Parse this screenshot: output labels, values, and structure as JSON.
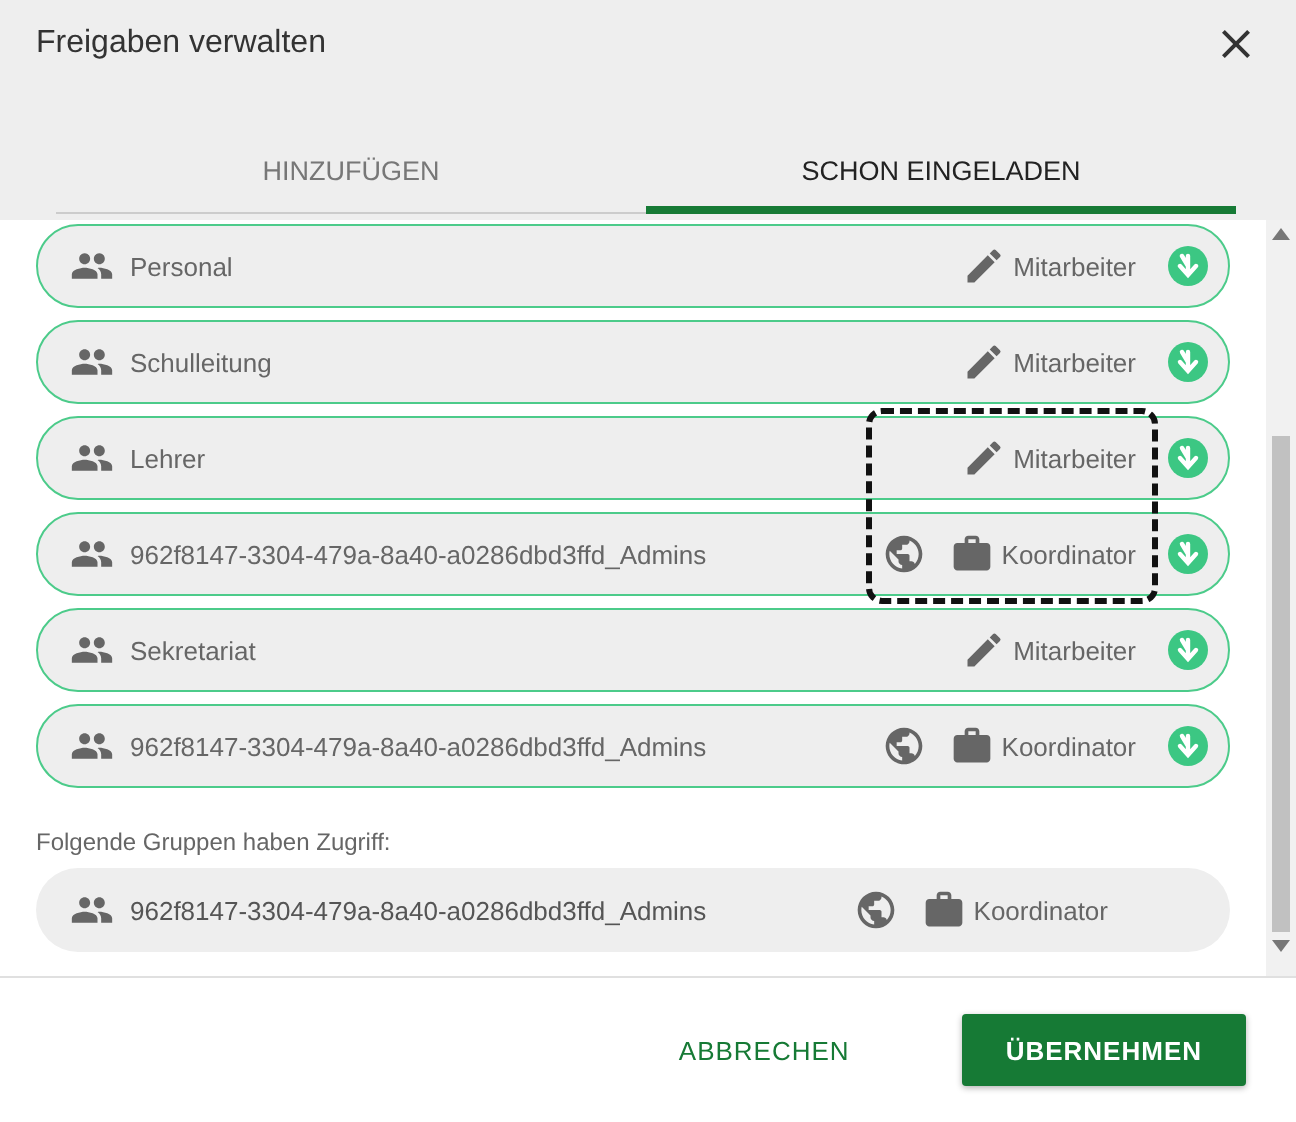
{
  "dialog": {
    "title": "Freigaben verwalten"
  },
  "tabs": [
    {
      "label": "HINZUFÜGEN",
      "selected": false
    },
    {
      "label": "SCHON EINGELADEN",
      "selected": true
    }
  ],
  "invited": [
    {
      "name": "Personal",
      "role": "Mitarbeiter",
      "kind": "edit",
      "global": false,
      "highlighted": false
    },
    {
      "name": "Schulleitung",
      "role": "Mitarbeiter",
      "kind": "edit",
      "global": false,
      "highlighted": false
    },
    {
      "name": "Lehrer",
      "role": "Mitarbeiter",
      "kind": "edit",
      "global": false,
      "highlighted": true
    },
    {
      "name": "962f8147-3304-479a-8a40-a0286dbd3ffd_Admins",
      "role": "Koordinator",
      "kind": "briefcase",
      "global": true,
      "highlighted": true
    },
    {
      "name": "Sekretariat",
      "role": "Mitarbeiter",
      "kind": "edit",
      "global": false,
      "highlighted": false
    },
    {
      "name": "962f8147-3304-479a-8a40-a0286dbd3ffd_Admins",
      "role": "Koordinator",
      "kind": "briefcase",
      "global": true,
      "highlighted": false
    }
  ],
  "access": {
    "label": "Folgende Gruppen haben Zugriff:",
    "groups": [
      {
        "name": "962f8147-3304-479a-8a40-a0286dbd3ffd_Admins",
        "role": "Koordinator",
        "kind": "briefcase",
        "global": true
      }
    ]
  },
  "buttons": [
    {
      "label": "ABBRECHEN",
      "kind": "text"
    },
    {
      "label": "ÜBERNEHMEN",
      "kind": "primary"
    }
  ]
}
